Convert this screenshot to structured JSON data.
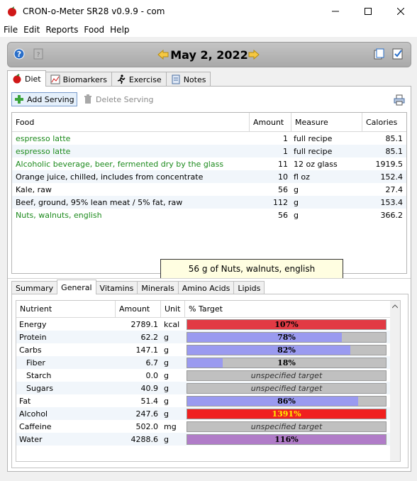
{
  "window": {
    "title": "CRON-o-Meter SR28 v0.9.9 - com"
  },
  "menu": [
    "File",
    "Edit",
    "Reports",
    "Food",
    "Help"
  ],
  "date_bar": {
    "date": "May 2, 2022"
  },
  "main_tabs": [
    {
      "label": "Diet"
    },
    {
      "label": "Biomarkers"
    },
    {
      "label": "Exercise"
    },
    {
      "label": "Notes"
    }
  ],
  "toolbar": {
    "add_label": "Add Serving",
    "delete_label": "Delete Serving"
  },
  "food_table": {
    "columns": [
      "Food",
      "Amount",
      "Measure",
      "Calories"
    ],
    "rows": [
      {
        "food": "espresso latte",
        "amount": "1",
        "measure": "full recipe",
        "calories": "85.1",
        "green": true
      },
      {
        "food": "espresso latte",
        "amount": "1",
        "measure": "full recipe",
        "calories": "85.1",
        "green": true
      },
      {
        "food": "Alcoholic beverage, beer, fermented dry by the glass",
        "amount": "11",
        "measure": "12 oz glass",
        "calories": "1919.5",
        "green": true
      },
      {
        "food": "Orange juice, chilled, includes from concentrate",
        "amount": "10",
        "measure": "fl oz",
        "calories": "152.4",
        "green": false
      },
      {
        "food": "Kale, raw",
        "amount": "56",
        "measure": "g",
        "calories": "27.4",
        "green": false
      },
      {
        "food": "Beef, ground, 95% lean meat / 5% fat, raw",
        "amount": "112",
        "measure": "g",
        "calories": "153.4",
        "green": false
      },
      {
        "food": "Nuts, walnuts, english",
        "amount": "56",
        "measure": "g",
        "calories": "366.2",
        "green": true
      }
    ],
    "tooltip": "56 g of Nuts, walnuts, english"
  },
  "sub_tabs": [
    "Summary",
    "General",
    "Vitamins",
    "Minerals",
    "Amino Acids",
    "Lipids"
  ],
  "nutrient_table": {
    "columns": [
      "Nutrient",
      "Amount",
      "Unit",
      "% Target"
    ],
    "rows": [
      {
        "name": "Energy",
        "indent": false,
        "amount": "2789.1",
        "unit": "kcal",
        "target": "107%",
        "pct": 107,
        "color": "#e23a44",
        "label_color": "#000000"
      },
      {
        "name": "Protein",
        "indent": false,
        "amount": "62.2",
        "unit": "g",
        "target": "78%",
        "pct": 78,
        "color": "#9a9af0",
        "label_color": "#000000"
      },
      {
        "name": "Carbs",
        "indent": false,
        "amount": "147.1",
        "unit": "g",
        "target": "82%",
        "pct": 82,
        "color": "#9a9af0",
        "label_color": "#000000"
      },
      {
        "name": "Fiber",
        "indent": true,
        "amount": "6.7",
        "unit": "g",
        "target": "18%",
        "pct": 18,
        "color": "#9a9af0",
        "label_color": "#000000"
      },
      {
        "name": "Starch",
        "indent": true,
        "amount": "0.0",
        "unit": "g",
        "target": "unspecified target",
        "pct": 0,
        "color": "#c0c0c0",
        "label_color": "#333333",
        "unspecified": true
      },
      {
        "name": "Sugars",
        "indent": true,
        "amount": "40.9",
        "unit": "g",
        "target": "unspecified target",
        "pct": 0,
        "color": "#c0c0c0",
        "label_color": "#333333",
        "unspecified": true
      },
      {
        "name": "Fat",
        "indent": false,
        "amount": "51.4",
        "unit": "g",
        "target": "86%",
        "pct": 86,
        "color": "#9a9af0",
        "label_color": "#000000"
      },
      {
        "name": "Alcohol",
        "indent": false,
        "amount": "247.6",
        "unit": "g",
        "target": "1391%",
        "pct": 1391,
        "color": "#f02020",
        "label_color": "#ffee00"
      },
      {
        "name": "Caffeine",
        "indent": false,
        "amount": "502.0",
        "unit": "mg",
        "target": "unspecified target",
        "pct": 0,
        "color": "#c0c0c0",
        "label_color": "#333333",
        "unspecified": true
      },
      {
        "name": "Water",
        "indent": false,
        "amount": "4288.6",
        "unit": "g",
        "target": "116%",
        "pct": 116,
        "color": "#b07cc8",
        "label_color": "#000000"
      }
    ]
  }
}
